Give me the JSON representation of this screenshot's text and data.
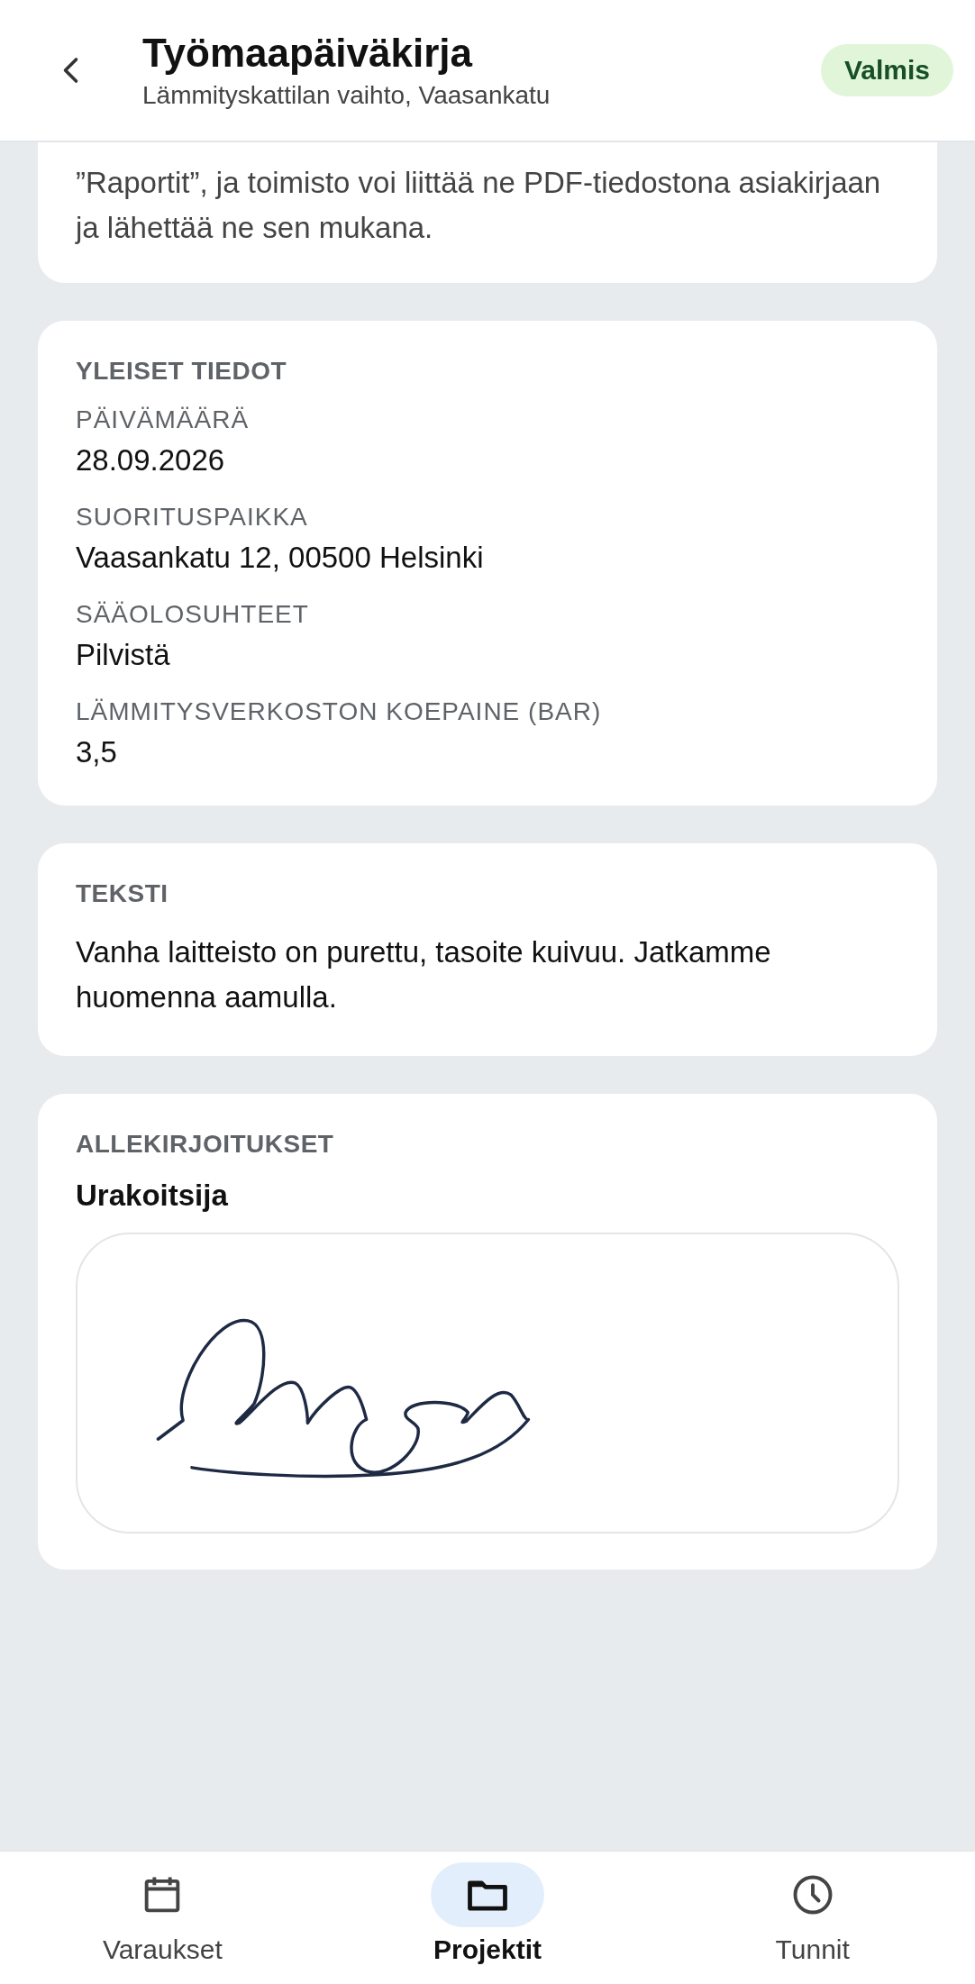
{
  "header": {
    "title": "Työmaapäiväkirja",
    "subtitle": "Lämmityskattilan vaihto, Vaasankatu",
    "status": "Valmis"
  },
  "intro": {
    "text": "”Raportit”, ja toimisto voi liittää ne PDF-tiedostona asiakirjaan ja lähettää ne sen mukana."
  },
  "general": {
    "heading": "YLEISET TIEDOT",
    "fields": [
      {
        "label": "PÄIVÄMÄÄRÄ",
        "value": "28.09.2026"
      },
      {
        "label": "SUORITUSPAIKKA",
        "value": "Vaasankatu 12, 00500 Helsinki"
      },
      {
        "label": "SÄÄOLOSUHTEET",
        "value": "Pilvistä"
      },
      {
        "label": "LÄMMITYSVERKOSTON KOEPAINE (BAR)",
        "value": "3,5"
      }
    ]
  },
  "text_section": {
    "heading": "TEKSTI",
    "body": "Vanha laitteisto on purettu, tasoite kuivuu. Jatkamme huomenna aamulla."
  },
  "signatures": {
    "heading": "ALLEKIRJOITUKSET",
    "signer": "Urakoitsija"
  },
  "nav": [
    {
      "kind": "calendar",
      "label": "Varaukset",
      "selected": false
    },
    {
      "kind": "folder",
      "label": "Projektit",
      "selected": true
    },
    {
      "kind": "clock",
      "label": "Tunnit",
      "selected": false
    }
  ]
}
